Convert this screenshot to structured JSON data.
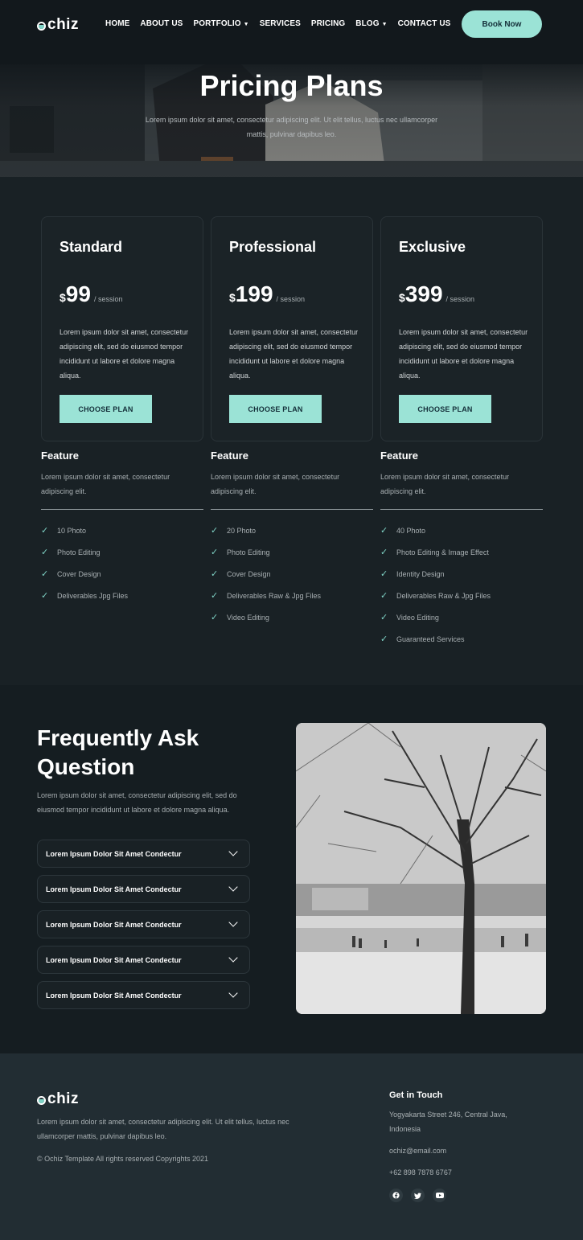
{
  "brand": {
    "name": "chiz",
    "accent": "#9be3d6",
    "background": "#192125"
  },
  "nav": {
    "items": [
      {
        "label": "HOME"
      },
      {
        "label": "ABOUT US"
      },
      {
        "label": "PORTFOLIO",
        "dropdown": true
      },
      {
        "label": "SERVICES"
      },
      {
        "label": "PRICING"
      },
      {
        "label": "BLOG",
        "dropdown": true
      },
      {
        "label": "CONTACT US"
      }
    ],
    "book_label": "Book Now"
  },
  "hero": {
    "title": "Pricing Plans",
    "subtitle": "Lorem ipsum dolor sit amet, consectetur adipiscing elit. Ut elit tellus, luctus nec ullamcorper mattis, pulvinar dapibus leo."
  },
  "plans": [
    {
      "name": "Standard",
      "currency": "$",
      "price": "99",
      "per": "/ session",
      "desc": "Lorem ipsum dolor sit amet, consectetur adipiscing elit, sed do eiusmod tempor incididunt ut labore et dolore magna aliqua.",
      "button": "CHOOSE PLAN",
      "feature_title": "Feature",
      "feature_desc": "Lorem ipsum dolor sit amet, consectetur adipiscing elit.",
      "features": [
        "10 Photo",
        "Photo Editing",
        "Cover Design",
        "Deliverables Jpg Files"
      ]
    },
    {
      "name": "Professional",
      "currency": "$",
      "price": "199",
      "per": "/ session",
      "desc": "Lorem ipsum dolor sit amet, consectetur adipiscing elit, sed do eiusmod tempor incididunt ut labore et dolore magna aliqua.",
      "button": "CHOOSE PLAN",
      "feature_title": "Feature",
      "feature_desc": "Lorem ipsum dolor sit amet, consectetur adipiscing elit.",
      "features": [
        "20 Photo",
        "Photo Editing",
        "Cover Design",
        "Deliverables Raw & Jpg Files",
        "Video Editing"
      ]
    },
    {
      "name": "Exclusive",
      "currency": "$",
      "price": "399",
      "per": "/ session",
      "desc": "Lorem ipsum dolor sit amet, consectetur adipiscing elit, sed do eiusmod tempor incididunt ut labore et dolore magna aliqua.",
      "button": "CHOOSE PLAN",
      "feature_title": "Feature",
      "feature_desc": "Lorem ipsum dolor sit amet, consectetur adipiscing elit.",
      "features": [
        "40 Photo",
        "Photo Editing & Image Effect",
        "Identity Design",
        "Deliverables Raw & Jpg Files",
        "Video Editing",
        "Guaranteed Services"
      ]
    }
  ],
  "faq": {
    "title": "Frequently Ask Question",
    "subtitle": "Lorem ipsum dolor sit amet, consectetur adipiscing elit, sed do eiusmod tempor incididunt ut labore et dolore magna aliqua.",
    "items": [
      "Lorem Ipsum Dolor Sit Amet Condectur",
      "Lorem Ipsum Dolor Sit Amet Condectur",
      "Lorem Ipsum Dolor Sit Amet Condectur",
      "Lorem Ipsum Dolor Sit Amet Condectur",
      "Lorem Ipsum Dolor Sit Amet Condectur"
    ]
  },
  "footer": {
    "desc": "Lorem ipsum dolor sit amet, consectetur adipiscing elit. Ut elit tellus, luctus nec ullamcorper mattis, pulvinar dapibus leo.",
    "copyright": "© Ochiz Template All rights reserved Copyrights 2021",
    "contact_title": "Get in Touch",
    "address": "Yogyakarta Street 246, Central Java, Indonesia",
    "email": "ochiz@email.com",
    "phone": "+62 898 7878 6767",
    "social": [
      "facebook-icon",
      "twitter-icon",
      "youtube-icon"
    ]
  }
}
